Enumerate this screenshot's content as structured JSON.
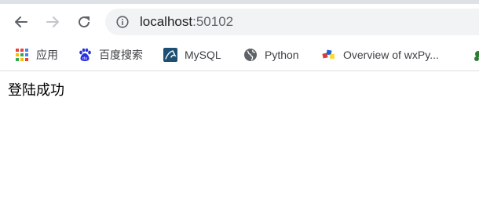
{
  "toolbar": {
    "back_icon": "arrow-left-icon",
    "forward_icon": "arrow-right-icon",
    "reload_icon": "reload-icon",
    "address_host": "localhost",
    "address_port": ":50102"
  },
  "bookmarks": [
    {
      "label": "应用",
      "icon": "apps-grid-icon"
    },
    {
      "label": "百度搜索",
      "icon": "baidu-paw-icon"
    },
    {
      "label": "MySQL",
      "icon": "mysql-icon"
    },
    {
      "label": "Python",
      "icon": "globe-icon"
    },
    {
      "label": "Overview of wxPy...",
      "icon": "wxpython-icon"
    }
  ],
  "page": {
    "message": "登陆成功"
  }
}
